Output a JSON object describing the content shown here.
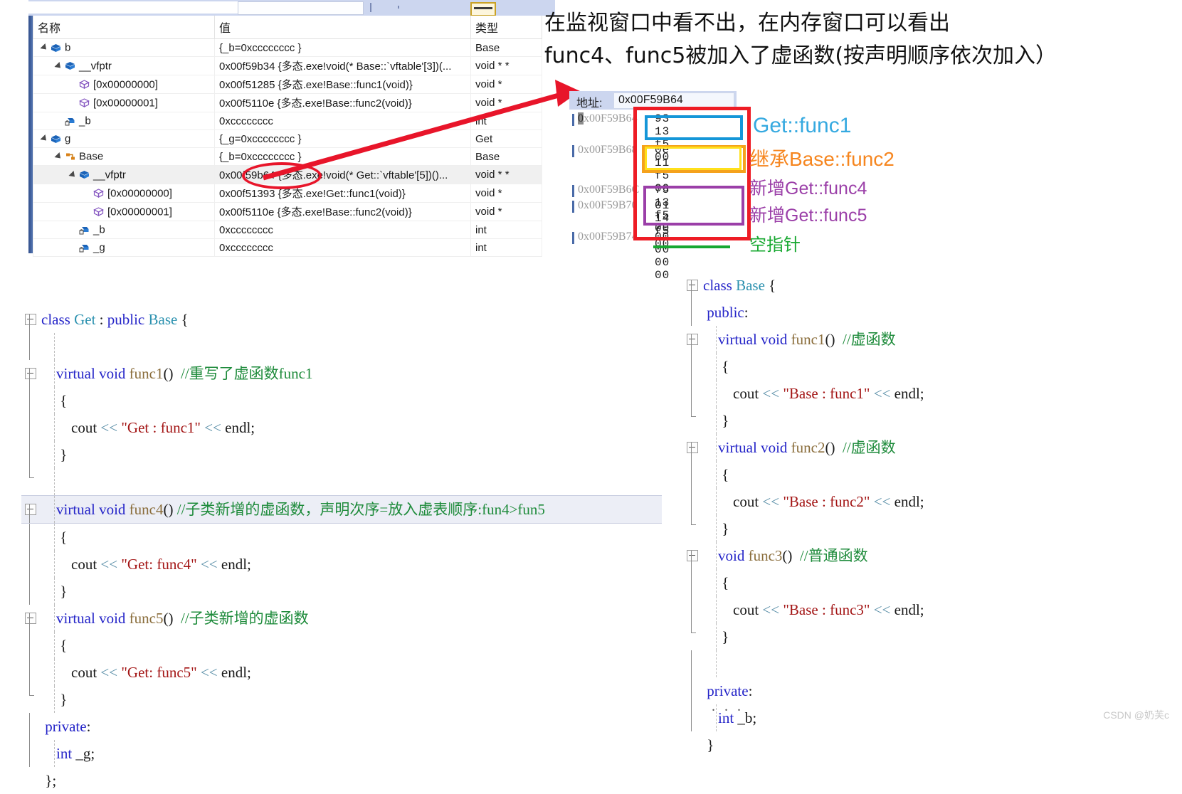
{
  "watch_window": {
    "columns": [
      "名称",
      "值",
      "类型"
    ],
    "rows": [
      {
        "indent": 1,
        "expander": true,
        "icon": "cube-blue-icon",
        "name": "b",
        "value": "{_b=0xcccccccc }",
        "type": "Base",
        "selected": false
      },
      {
        "indent": 2,
        "expander": true,
        "icon": "cube-blue-icon",
        "name": "__vfptr",
        "value": "0x00f59b34 {多态.exe!void(* Base::`vftable'[3])(...",
        "type": "void * *",
        "selected": false
      },
      {
        "indent": 3,
        "expander": false,
        "icon": "cube-purple-icon",
        "name": "[0x00000000]",
        "value": "0x00f51285 {多态.exe!Base::func1(void)}",
        "type": "void *",
        "selected": false
      },
      {
        "indent": 3,
        "expander": false,
        "icon": "cube-purple-icon",
        "name": "[0x00000001]",
        "value": "0x00f5110e {多态.exe!Base::func2(void)}",
        "type": "void *",
        "selected": false
      },
      {
        "indent": 2,
        "expander": false,
        "icon": "field-lock-icon",
        "name": "_b",
        "value": "0xcccccccc",
        "type": "int",
        "selected": false
      },
      {
        "indent": 1,
        "expander": true,
        "icon": "cube-blue-icon",
        "name": "g",
        "value": "{_g=0xcccccccc }",
        "type": "Get",
        "selected": false
      },
      {
        "indent": 2,
        "expander": true,
        "icon": "base-orange-icon",
        "name": "Base",
        "value": "{_b=0xcccccccc }",
        "type": "Base",
        "selected": false
      },
      {
        "indent": 3,
        "expander": true,
        "icon": "cube-blue-icon",
        "name": "__vfptr",
        "value": "0x00f59b64 {多态.exe!void(* Get::`vftable'[5])()...",
        "type": "void * *",
        "selected": true
      },
      {
        "indent": 4,
        "expander": false,
        "icon": "cube-purple-icon",
        "name": "[0x00000000]",
        "value": "0x00f51393 {多态.exe!Get::func1(void)}",
        "type": "void *",
        "selected": false
      },
      {
        "indent": 4,
        "expander": false,
        "icon": "cube-purple-icon",
        "name": "[0x00000001]",
        "value": "0x00f5110e {多态.exe!Base::func2(void)}",
        "type": "void *",
        "selected": false
      },
      {
        "indent": 3,
        "expander": false,
        "icon": "field-lock-icon",
        "name": "_b",
        "value": "0xcccccccc",
        "type": "int",
        "selected": false
      },
      {
        "indent": 3,
        "expander": false,
        "icon": "field-lock-icon",
        "name": "_g",
        "value": "0xcccccccc",
        "type": "int",
        "selected": false
      }
    ]
  },
  "memory_window": {
    "address_label": "地址:",
    "address_value": "0x00F59B64",
    "rows": [
      {
        "address": "0x00F59B64",
        "bytes": "93 13 f5 00",
        "highlight_first_char": true
      },
      {
        "address": "0x00F59B68",
        "bytes": "0e 11 f5 00",
        "highlight_first_char": false
      },
      {
        "address": "0x00F59B6C",
        "bytes": "75 13 f5 00",
        "highlight_first_char": false
      },
      {
        "address": "0x00F59B70",
        "bytes": "01 14 f5 00",
        "highlight_first_char": false
      },
      {
        "address": "0x00F59B74",
        "bytes": "00 00 00 00",
        "highlight_first_char": false
      }
    ]
  },
  "annotations": {
    "top_note_line1": "在监视窗口中看不出，在内存窗口可以看出",
    "top_note_line2": "func4、func5被加入了虚函数(按声明顺序依次加入）",
    "memory_labels": [
      {
        "text": "Get::func1",
        "color": "#35a9e0"
      },
      {
        "text": "继承Base::func2",
        "color": "#f6861f"
      },
      {
        "text": "新增Get::func4",
        "color": "#9b3fa8"
      },
      {
        "text": "新增Get::func5",
        "color": "#9b3fa8"
      },
      {
        "text": "空指针",
        "color": "#17a830"
      }
    ],
    "colors": {
      "red_box": "#ee1c25",
      "blue_box": "#1596d8",
      "orange_box": "#f5a21c",
      "yellow_box": "#ffe01b",
      "purple_box": "#9b3fa8",
      "green_underline": "#17a830",
      "red_arrow": "#e8152a",
      "red_ellipse": "#e8152a"
    }
  },
  "code_left": {
    "title": "class Get : public Base",
    "lines": [
      {
        "gutter": "box",
        "dash": false,
        "hl": false,
        "tokens": [
          {
            "t": "class ",
            "c": "k"
          },
          {
            "t": "Get",
            "c": "t"
          },
          {
            "t": " : ",
            "c": "p"
          },
          {
            "t": "public ",
            "c": "k"
          },
          {
            "t": "Base",
            "c": "t"
          },
          {
            "t": " {",
            "c": "p"
          }
        ]
      },
      {
        "gutter": "line",
        "dash": true,
        "hl": false,
        "tokens": []
      },
      {
        "gutter": "box",
        "dash": true,
        "hl": false,
        "tokens": [
          {
            "t": "    ",
            "c": "p"
          },
          {
            "t": "virtual",
            "c": "k"
          },
          {
            "t": " ",
            "c": "p"
          },
          {
            "t": "void",
            "c": "k"
          },
          {
            "t": " ",
            "c": "p"
          },
          {
            "t": "func1",
            "c": "f"
          },
          {
            "t": "()",
            "c": "p"
          },
          {
            "t": "  ",
            "c": "p"
          },
          {
            "t": "//重写了虚函数func1",
            "c": "cm"
          }
        ]
      },
      {
        "gutter": "line",
        "dash": true,
        "hl": false,
        "tokens": [
          {
            "t": "     {",
            "c": "p"
          }
        ]
      },
      {
        "gutter": "line",
        "dash": true,
        "hl": false,
        "tokens": [
          {
            "t": "        cout ",
            "c": "p"
          },
          {
            "t": "<<",
            "c": "op"
          },
          {
            "t": " ",
            "c": "p"
          },
          {
            "t": "\"Get : func1\"",
            "c": "s"
          },
          {
            "t": " ",
            "c": "p"
          },
          {
            "t": "<<",
            "c": "op"
          },
          {
            "t": " endl;",
            "c": "p"
          }
        ]
      },
      {
        "gutter": "line",
        "dash": true,
        "hl": false,
        "tokens": [
          {
            "t": "     }",
            "c": "p"
          }
        ]
      },
      {
        "gutter": "vend",
        "dash": true,
        "hl": false,
        "tokens": []
      },
      {
        "gutter": "box",
        "dash": true,
        "hl": true,
        "tokens": [
          {
            "t": "    ",
            "c": "p"
          },
          {
            "t": "virtual",
            "c": "k"
          },
          {
            "t": " ",
            "c": "p"
          },
          {
            "t": "void",
            "c": "k"
          },
          {
            "t": " ",
            "c": "p"
          },
          {
            "t": "func4",
            "c": "f"
          },
          {
            "t": "()",
            "c": "p"
          },
          {
            "t": " ",
            "c": "p"
          },
          {
            "t": "//子类新增的虚函数，声明次序=放入虚表顺序:fun4>fun5",
            "c": "cm"
          }
        ]
      },
      {
        "gutter": "line",
        "dash": true,
        "hl": false,
        "tokens": [
          {
            "t": "     {",
            "c": "p"
          }
        ]
      },
      {
        "gutter": "line",
        "dash": true,
        "hl": false,
        "tokens": [
          {
            "t": "        cout ",
            "c": "p"
          },
          {
            "t": "<<",
            "c": "op"
          },
          {
            "t": " ",
            "c": "p"
          },
          {
            "t": "\"Get: func4\"",
            "c": "s"
          },
          {
            "t": " ",
            "c": "p"
          },
          {
            "t": "<<",
            "c": "op"
          },
          {
            "t": " endl;",
            "c": "p"
          }
        ]
      },
      {
        "gutter": "line",
        "dash": true,
        "hl": false,
        "tokens": [
          {
            "t": "     }",
            "c": "p"
          }
        ]
      },
      {
        "gutter": "box",
        "dash": true,
        "hl": false,
        "tokens": [
          {
            "t": "    ",
            "c": "p"
          },
          {
            "t": "virtual",
            "c": "k"
          },
          {
            "t": " ",
            "c": "p"
          },
          {
            "t": "void",
            "c": "k"
          },
          {
            "t": " ",
            "c": "p"
          },
          {
            "t": "func5",
            "c": "f"
          },
          {
            "t": "()",
            "c": "p"
          },
          {
            "t": "  ",
            "c": "p"
          },
          {
            "t": "//子类新增的虚函数",
            "c": "cm"
          }
        ]
      },
      {
        "gutter": "line",
        "dash": true,
        "hl": false,
        "tokens": [
          {
            "t": "     {",
            "c": "p"
          }
        ]
      },
      {
        "gutter": "line",
        "dash": true,
        "hl": false,
        "tokens": [
          {
            "t": "        cout ",
            "c": "p"
          },
          {
            "t": "<<",
            "c": "op"
          },
          {
            "t": " ",
            "c": "p"
          },
          {
            "t": "\"Get: func5\"",
            "c": "s"
          },
          {
            "t": " ",
            "c": "p"
          },
          {
            "t": "<<",
            "c": "op"
          },
          {
            "t": " endl;",
            "c": "p"
          }
        ]
      },
      {
        "gutter": "vend",
        "dash": true,
        "hl": false,
        "tokens": [
          {
            "t": "     }",
            "c": "p"
          }
        ]
      },
      {
        "gutter": "line",
        "dash": false,
        "hl": false,
        "tokens": [
          {
            "t": " ",
            "c": "p"
          },
          {
            "t": "private",
            "c": "k"
          },
          {
            "t": ":",
            "c": "p"
          }
        ]
      },
      {
        "gutter": "line",
        "dash": true,
        "hl": false,
        "tokens": [
          {
            "t": "    ",
            "c": "p"
          },
          {
            "t": "int",
            "c": "k"
          },
          {
            "t": " _g;",
            "c": "p"
          }
        ]
      },
      {
        "gutter": "none",
        "dash": false,
        "hl": false,
        "tokens": [
          {
            "t": " };",
            "c": "p"
          }
        ]
      }
    ]
  },
  "code_right": {
    "title": "class Base",
    "lines": [
      {
        "gutter": "box",
        "dash": false,
        "hl": false,
        "tokens": [
          {
            "t": "class ",
            "c": "k"
          },
          {
            "t": "Base",
            "c": "t"
          },
          {
            "t": " {",
            "c": "p"
          }
        ]
      },
      {
        "gutter": "line",
        "dash": false,
        "hl": false,
        "tokens": [
          {
            "t": " ",
            "c": "p"
          },
          {
            "t": "public",
            "c": "k"
          },
          {
            "t": ":",
            "c": "p"
          }
        ]
      },
      {
        "gutter": "box",
        "dash": true,
        "hl": false,
        "tokens": [
          {
            "t": "    ",
            "c": "p"
          },
          {
            "t": "virtual",
            "c": "k"
          },
          {
            "t": " ",
            "c": "p"
          },
          {
            "t": "void",
            "c": "k"
          },
          {
            "t": " ",
            "c": "p"
          },
          {
            "t": "func1",
            "c": "f"
          },
          {
            "t": "()",
            "c": "p"
          },
          {
            "t": "  ",
            "c": "p"
          },
          {
            "t": "//虚函数",
            "c": "cm"
          }
        ]
      },
      {
        "gutter": "line",
        "dash": true,
        "hl": false,
        "tokens": [
          {
            "t": "     {",
            "c": "p"
          }
        ]
      },
      {
        "gutter": "line",
        "dash": true,
        "hl": false,
        "tokens": [
          {
            "t": "        cout ",
            "c": "p"
          },
          {
            "t": "<<",
            "c": "op"
          },
          {
            "t": " ",
            "c": "p"
          },
          {
            "t": "\"Base : func1\"",
            "c": "s"
          },
          {
            "t": " ",
            "c": "p"
          },
          {
            "t": "<<",
            "c": "op"
          },
          {
            "t": " endl;",
            "c": "p"
          }
        ]
      },
      {
        "gutter": "vend",
        "dash": true,
        "hl": false,
        "tokens": [
          {
            "t": "     }",
            "c": "p"
          }
        ]
      },
      {
        "gutter": "box",
        "dash": true,
        "hl": false,
        "tokens": [
          {
            "t": "    ",
            "c": "p"
          },
          {
            "t": "virtual",
            "c": "k"
          },
          {
            "t": " ",
            "c": "p"
          },
          {
            "t": "void",
            "c": "k"
          },
          {
            "t": " ",
            "c": "p"
          },
          {
            "t": "func2",
            "c": "f"
          },
          {
            "t": "()",
            "c": "p"
          },
          {
            "t": "  ",
            "c": "p"
          },
          {
            "t": "//虚函数",
            "c": "cm"
          }
        ]
      },
      {
        "gutter": "line",
        "dash": true,
        "hl": false,
        "tokens": [
          {
            "t": "     {",
            "c": "p"
          }
        ]
      },
      {
        "gutter": "line",
        "dash": true,
        "hl": false,
        "tokens": [
          {
            "t": "        cout ",
            "c": "p"
          },
          {
            "t": "<<",
            "c": "op"
          },
          {
            "t": " ",
            "c": "p"
          },
          {
            "t": "\"Base : func2\"",
            "c": "s"
          },
          {
            "t": " ",
            "c": "p"
          },
          {
            "t": "<<",
            "c": "op"
          },
          {
            "t": " endl;",
            "c": "p"
          }
        ]
      },
      {
        "gutter": "vend",
        "dash": true,
        "hl": false,
        "tokens": [
          {
            "t": "     }",
            "c": "p"
          }
        ]
      },
      {
        "gutter": "box",
        "dash": true,
        "hl": false,
        "tokens": [
          {
            "t": "    ",
            "c": "p"
          },
          {
            "t": "void",
            "c": "k"
          },
          {
            "t": " ",
            "c": "p"
          },
          {
            "t": "func3",
            "c": "f"
          },
          {
            "t": "()",
            "c": "p"
          },
          {
            "t": "  ",
            "c": "p"
          },
          {
            "t": "//普通函数",
            "c": "cm"
          }
        ]
      },
      {
        "gutter": "line",
        "dash": true,
        "hl": false,
        "tokens": [
          {
            "t": "     {",
            "c": "p"
          }
        ]
      },
      {
        "gutter": "line",
        "dash": true,
        "hl": false,
        "tokens": [
          {
            "t": "        cout ",
            "c": "p"
          },
          {
            "t": "<<",
            "c": "op"
          },
          {
            "t": " ",
            "c": "p"
          },
          {
            "t": "\"Base : func3\"",
            "c": "s"
          },
          {
            "t": " ",
            "c": "p"
          },
          {
            "t": "<<",
            "c": "op"
          },
          {
            "t": " endl;",
            "c": "p"
          }
        ]
      },
      {
        "gutter": "vend",
        "dash": true,
        "hl": false,
        "tokens": [
          {
            "t": "     }",
            "c": "p"
          }
        ]
      },
      {
        "gutter": "line",
        "dash": true,
        "hl": false,
        "tokens": []
      },
      {
        "gutter": "line",
        "dash": false,
        "hl": false,
        "tokens": [
          {
            "t": " ",
            "c": "p"
          },
          {
            "t": "private",
            "c": "k"
          },
          {
            "t": ":",
            "c": "p"
          }
        ]
      },
      {
        "gutter": "line",
        "dash": true,
        "hl": false,
        "tokens": [
          {
            "t": "    ",
            "c": "p"
          },
          {
            "t": "int",
            "c": "k"
          },
          {
            "t": " _b;",
            "c": "p"
          }
        ]
      },
      {
        "gutter": "none",
        "dash": false,
        "hl": false,
        "tokens": [
          {
            "t": " }",
            "c": "p"
          }
        ]
      }
    ],
    "ellipsis": ". . ."
  },
  "watermark": "CSDN @奶芙c"
}
